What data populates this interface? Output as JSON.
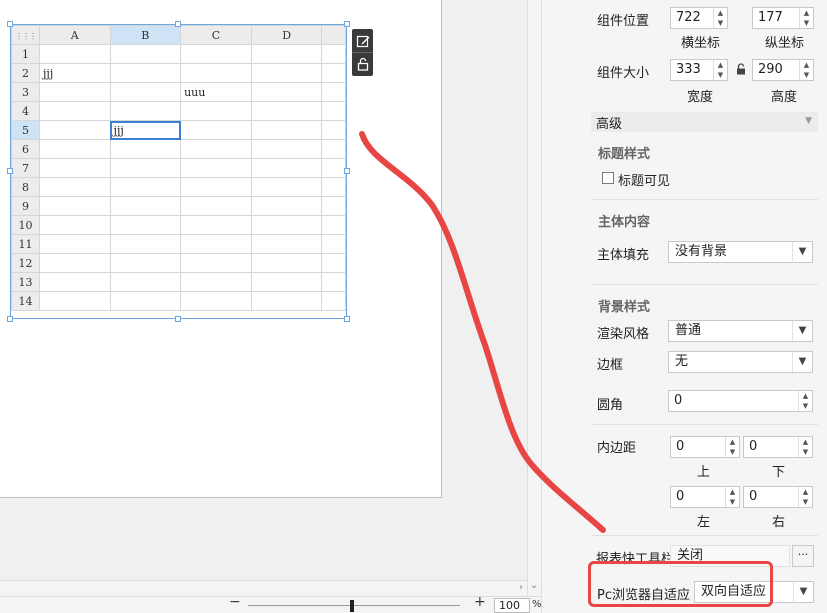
{
  "sheet": {
    "columns": [
      "A",
      "B",
      "C",
      "D"
    ],
    "rows": [
      "1",
      "2",
      "3",
      "4",
      "5",
      "6",
      "7",
      "8",
      "9",
      "10",
      "11",
      "12",
      "13",
      "14"
    ],
    "cells": {
      "A2": "jjj",
      "C3": "uuu",
      "B5": "jjj"
    }
  },
  "side_tools": {
    "edit_icon": "edit-icon",
    "lock_icon": "unlock-icon"
  },
  "zoom": {
    "value": "100",
    "unit": "%",
    "minus": "−",
    "plus": "+"
  },
  "panel": {
    "position": {
      "label": "组件位置",
      "x_value": "722",
      "y_value": "177",
      "x_caption": "横坐标",
      "y_caption": "纵坐标"
    },
    "size": {
      "label": "组件大小",
      "width_value": "333",
      "height_value": "290",
      "width_caption": "宽度",
      "height_caption": "高度"
    },
    "advanced": "高级",
    "title_style": {
      "heading": "标题样式",
      "visible_label": "标题可见"
    },
    "body_content": {
      "heading": "主体内容",
      "fill_label": "主体填充",
      "fill_value": "没有背景"
    },
    "background_style": {
      "heading": "背景样式",
      "render_label": "渲染风格",
      "render_value": "普通",
      "border_label": "边框",
      "border_value": "无",
      "radius_label": "圆角",
      "radius_value": "0"
    },
    "padding": {
      "label": "内边距",
      "top": "0",
      "bottom": "0",
      "left": "0",
      "right": "0",
      "top_caption": "上",
      "bottom_caption": "下",
      "left_caption": "左",
      "right_caption": "右"
    },
    "toolbar": {
      "label": "报表快工具栏",
      "value": "关闭",
      "more": "···"
    },
    "pc_adapt": {
      "label": "Pc浏览器自适应",
      "value": "双向自适应"
    }
  },
  "colors": {
    "annotation": "#e84545",
    "selection": "#3b80d2"
  }
}
